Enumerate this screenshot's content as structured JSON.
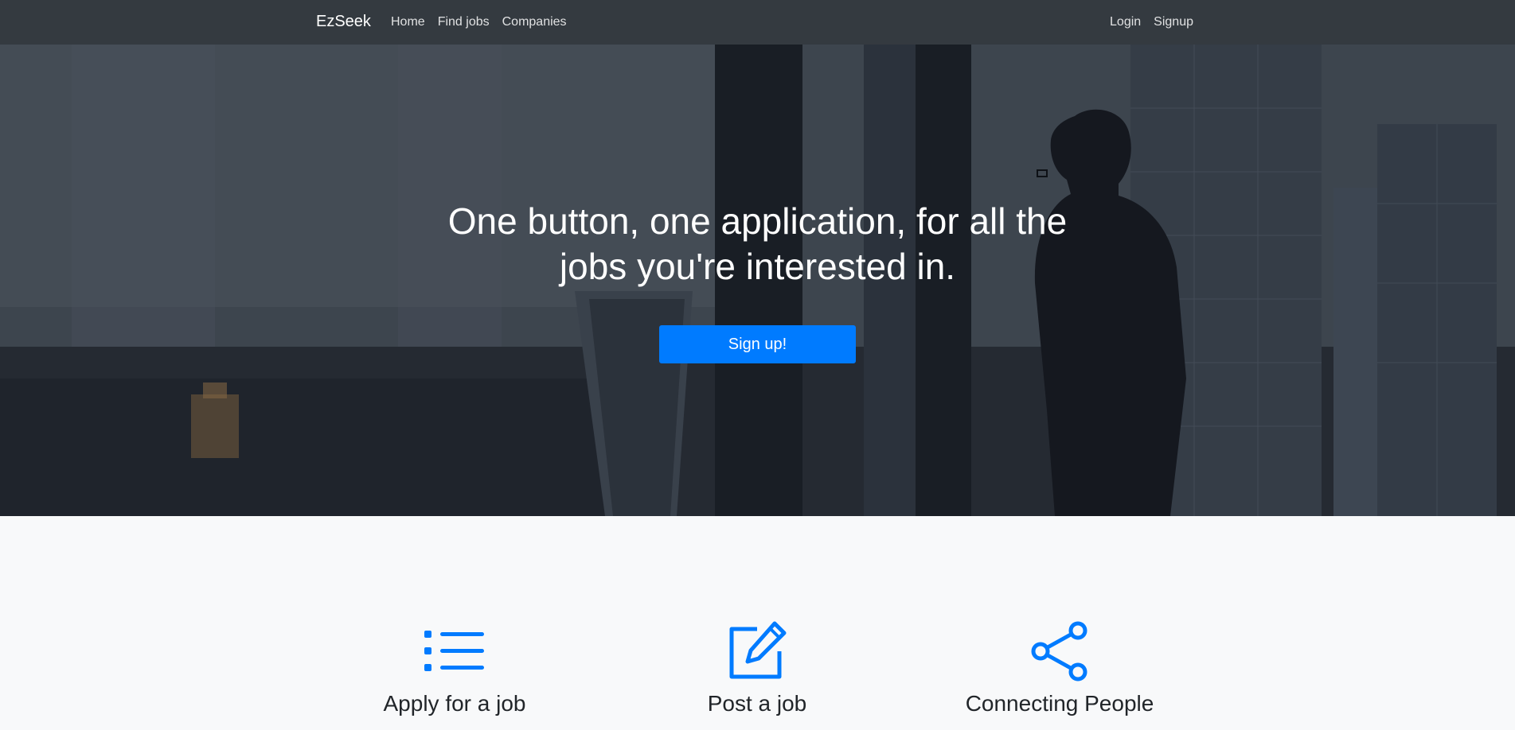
{
  "navbar": {
    "brand": "EzSeek",
    "left_links": [
      "Home",
      "Find jobs",
      "Companies"
    ],
    "right_links": [
      "Login",
      "Signup"
    ]
  },
  "hero": {
    "heading_line1": "One button, one application, for all the",
    "heading_line2": "jobs you're interested in.",
    "signup_label": "Sign up!"
  },
  "features": [
    {
      "icon": "list-icon",
      "title": "Apply for a job"
    },
    {
      "icon": "edit-icon",
      "title": "Post a job"
    },
    {
      "icon": "share-icon",
      "title": "Connecting People"
    }
  ],
  "colors": {
    "navbar_bg": "#343a40",
    "accent": "#007bff",
    "page_bg": "#f8f9fa",
    "text_dark": "#212529"
  }
}
